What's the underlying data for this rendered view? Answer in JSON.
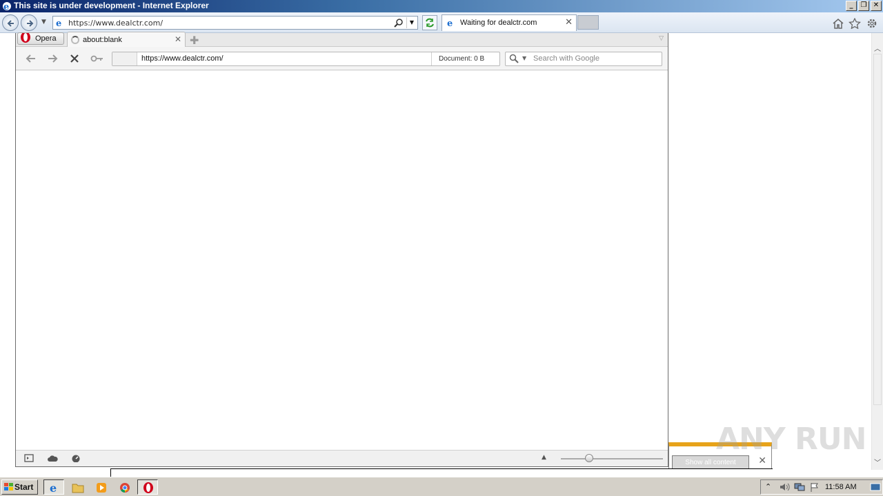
{
  "ie": {
    "title": "This site is under development - Internet Explorer",
    "address": "https://www.dealctr.com/",
    "tab_title": "Waiting for dealctr.com",
    "window_buttons": [
      "_",
      "❐",
      "✕"
    ]
  },
  "opera": {
    "menu_label": "Opera",
    "tab_title": "about:blank",
    "address": "https://www.dealctr.com/",
    "document_info": "Document:   0 B",
    "search_placeholder": "Search with Google"
  },
  "notification": {
    "button_label": "Show all content"
  },
  "watermark": "ANY RUN",
  "taskbar": {
    "start_label": "Start",
    "clock": "11:58 AM"
  }
}
